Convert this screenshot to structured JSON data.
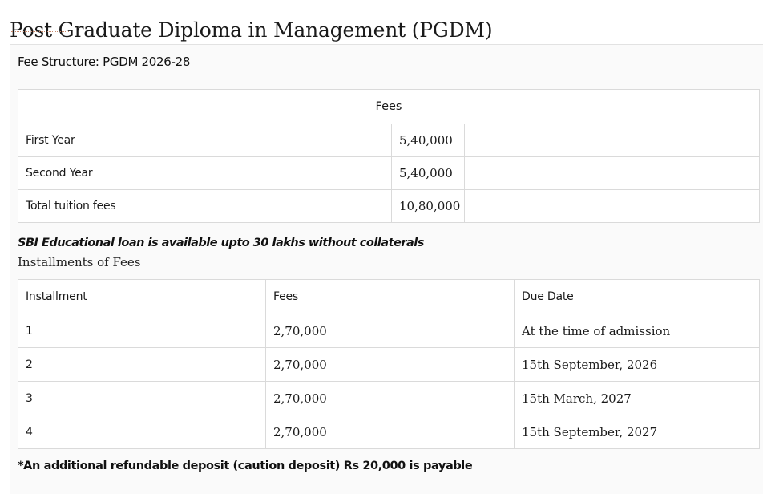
{
  "page": {
    "title": "Post Graduate Diploma in Management (PGDM)"
  },
  "fee_structure": {
    "heading": "Fee Structure: PGDM 2026-28",
    "column_header": "Fees",
    "rows": [
      {
        "label": "First Year",
        "amount": "5,40,000"
      },
      {
        "label": "Second Year",
        "amount": "5,40,000"
      },
      {
        "label": "Total tuition fees",
        "amount": "10,80,000"
      }
    ]
  },
  "loan_note": "SBI Educational loan is available upto 30 lakhs without collaterals",
  "installments": {
    "caption": "Installments of Fees",
    "headers": [
      "Installment",
      "Fees",
      "Due Date"
    ],
    "rows": [
      {
        "installment": "1",
        "fees": "2,70,000",
        "due_date": "At the time of admission"
      },
      {
        "installment": "2",
        "fees": "2,70,000",
        "due_date": "15th September, 2026"
      },
      {
        "installment": "3",
        "fees": "2,70,000",
        "due_date": "15th March, 2027"
      },
      {
        "installment": "4",
        "fees": "2,70,000",
        "due_date": "15th September, 2027"
      }
    ]
  },
  "deposit_note": "*An additional refundable deposit (caution deposit) Rs 20,000 is payable"
}
